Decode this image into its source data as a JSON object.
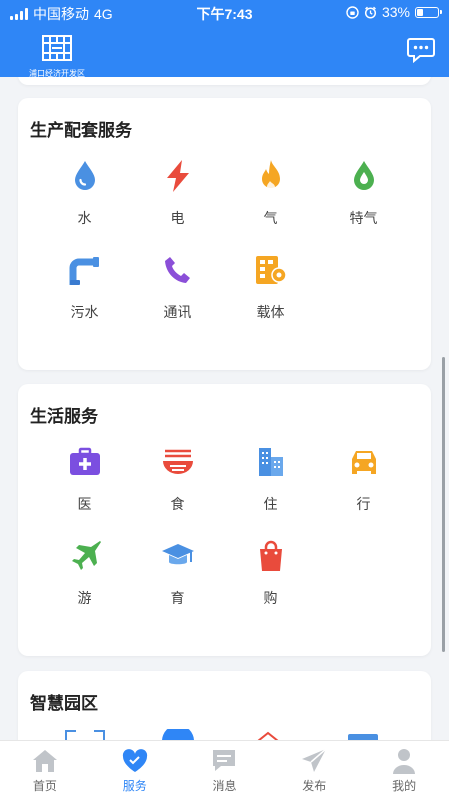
{
  "status_bar": {
    "carrier": "中国移动",
    "network": "4G",
    "time": "下午7:43",
    "battery_percent": "33%",
    "battery_level": 0.33
  },
  "header": {
    "logo_text": "浦口经济开发区",
    "chat_icon": "chat-bubble-icon"
  },
  "sections": [
    {
      "title": "生产配套服务",
      "items": [
        {
          "label": "水",
          "icon": "water-drop-icon",
          "color": "#4a90e2"
        },
        {
          "label": "电",
          "icon": "lightning-icon",
          "color": "#e94b3c"
        },
        {
          "label": "气",
          "icon": "flame-icon",
          "color": "#f5a623"
        },
        {
          "label": "特气",
          "icon": "green-drop-icon",
          "color": "#4cb050"
        },
        {
          "label": "污水",
          "icon": "sewage-pipe-icon",
          "color": "#4a90e2"
        },
        {
          "label": "通讯",
          "icon": "phone-icon",
          "color": "#8b4fd8"
        },
        {
          "label": "载体",
          "icon": "building-gear-icon",
          "color": "#f5a623"
        }
      ]
    },
    {
      "title": "生活服务",
      "items": [
        {
          "label": "医",
          "icon": "medical-kit-icon",
          "color": "#7b4fe0"
        },
        {
          "label": "食",
          "icon": "noodle-bowl-icon",
          "color": "#e94b3c"
        },
        {
          "label": "住",
          "icon": "buildings-icon",
          "color": "#4a90e2"
        },
        {
          "label": "行",
          "icon": "car-icon",
          "color": "#f5a623"
        },
        {
          "label": "游",
          "icon": "airplane-icon",
          "color": "#4cb050"
        },
        {
          "label": "育",
          "icon": "graduation-cap-icon",
          "color": "#4a90e2"
        },
        {
          "label": "购",
          "icon": "shopping-bag-icon",
          "color": "#e94b3c"
        }
      ]
    },
    {
      "title": "智慧园区",
      "items": []
    }
  ],
  "tabs": [
    {
      "label": "首页",
      "icon": "home-icon",
      "active": false
    },
    {
      "label": "服务",
      "icon": "heart-icon",
      "active": true
    },
    {
      "label": "消息",
      "icon": "message-icon",
      "active": false
    },
    {
      "label": "发布",
      "icon": "send-icon",
      "active": false
    },
    {
      "label": "我的",
      "icon": "user-icon",
      "active": false
    }
  ],
  "colors": {
    "primary": "#2f86f6",
    "background": "#f2f4f7",
    "tab_inactive": "#c0c4c9"
  }
}
